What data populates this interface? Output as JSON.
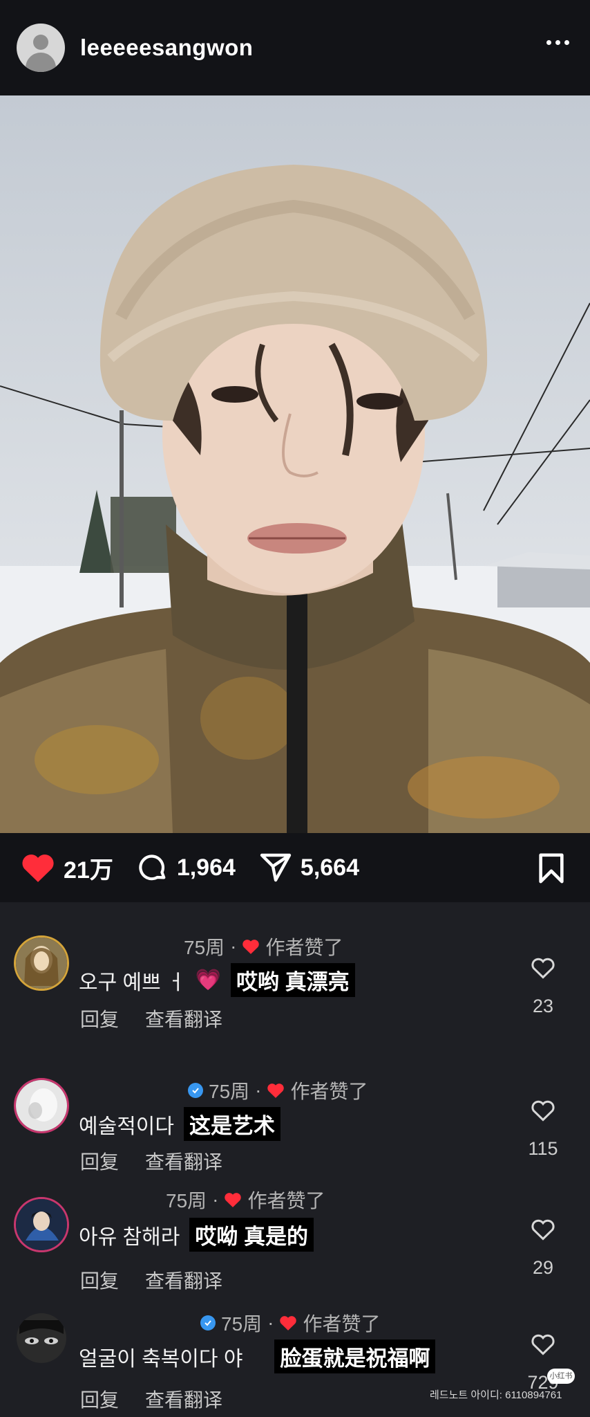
{
  "header": {
    "username": "leeeeesangwon"
  },
  "actions": {
    "likes": "21万",
    "comments": "1,964",
    "shares": "5,664"
  },
  "comments": [
    {
      "time": "75周",
      "liked_by_author": "作者赞了",
      "text": "오구 예쁘 ㅓ",
      "emoji": "💗",
      "translation": "哎哟 真漂亮",
      "reply": "回复",
      "translate": "查看翻译",
      "like_count": "23"
    },
    {
      "time": "75周",
      "liked_by_author": "作者赞了",
      "text": "예술적이다",
      "translation": "这是艺术",
      "reply": "回复",
      "translate": "查看翻译",
      "like_count": "115"
    },
    {
      "time": "75周",
      "liked_by_author": "作者赞了",
      "text": "아유 참해라",
      "translation": "哎呦 真是的",
      "reply": "回复",
      "translate": "查看翻译",
      "like_count": "29"
    },
    {
      "time": "75周",
      "liked_by_author": "作者赞了",
      "text": "얼굴이 축복이다 야",
      "translation": "脸蛋就是祝福啊",
      "reply": "回复",
      "translate": "查看翻译",
      "like_count": "729"
    }
  ],
  "watermark": {
    "text": "레드노트 아이디: 6110894761",
    "badge": "小红书"
  },
  "colors": {
    "like_red": "#ff2d3a",
    "verified_blue": "#3897f0",
    "header_bg": "#121317",
    "comments_bg": "#1e1f24"
  },
  "icons": [
    "ellipsis-icon",
    "heart-filled-icon",
    "comment-icon",
    "share-icon",
    "bookmark-icon",
    "heart-outline-icon",
    "verified-icon"
  ]
}
